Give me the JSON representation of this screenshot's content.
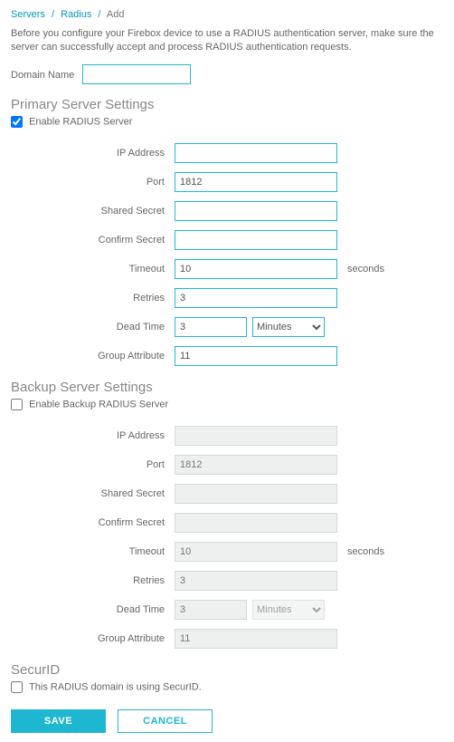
{
  "breadcrumbs": {
    "0": {
      "label": "Servers"
    },
    "1": {
      "label": "Radius"
    },
    "current": "Add",
    "sep": "/"
  },
  "intro": "Before you configure your Firebox device to use a RADIUS authentication server, make sure the server can successfully accept and process RADIUS authentication requests.",
  "domainName": {
    "label": "Domain Name",
    "value": ""
  },
  "primary": {
    "title": "Primary Server Settings",
    "enable": {
      "label": "Enable RADIUS Server",
      "checked": true
    },
    "fields": {
      "ip": {
        "label": "IP Address",
        "value": ""
      },
      "port": {
        "label": "Port",
        "value": "1812"
      },
      "secret": {
        "label": "Shared Secret",
        "value": ""
      },
      "confirm": {
        "label": "Confirm Secret",
        "value": ""
      },
      "timeout": {
        "label": "Timeout",
        "value": "10",
        "unit": "seconds"
      },
      "retries": {
        "label": "Retries",
        "value": "3"
      },
      "deadtime": {
        "label": "Dead Time",
        "value": "3",
        "unit": "Minutes"
      },
      "groupattr": {
        "label": "Group Attribute",
        "value": "11"
      }
    }
  },
  "backup": {
    "title": "Backup Server Settings",
    "enable": {
      "label": "Enable Backup RADIUS Server",
      "checked": false
    },
    "fields": {
      "ip": {
        "label": "IP Address",
        "value": ""
      },
      "port": {
        "label": "Port",
        "value": "1812"
      },
      "secret": {
        "label": "Shared Secret",
        "value": ""
      },
      "confirm": {
        "label": "Confirm Secret",
        "value": ""
      },
      "timeout": {
        "label": "Timeout",
        "value": "10",
        "unit": "seconds"
      },
      "retries": {
        "label": "Retries",
        "value": "3"
      },
      "deadtime": {
        "label": "Dead Time",
        "value": "3",
        "unit": "Minutes"
      },
      "groupattr": {
        "label": "Group Attribute",
        "value": "11"
      }
    }
  },
  "securid": {
    "title": "SecurID",
    "label": "This RADIUS domain is using SecurID.",
    "checked": false
  },
  "buttons": {
    "save": "SAVE",
    "cancel": "CANCEL"
  }
}
